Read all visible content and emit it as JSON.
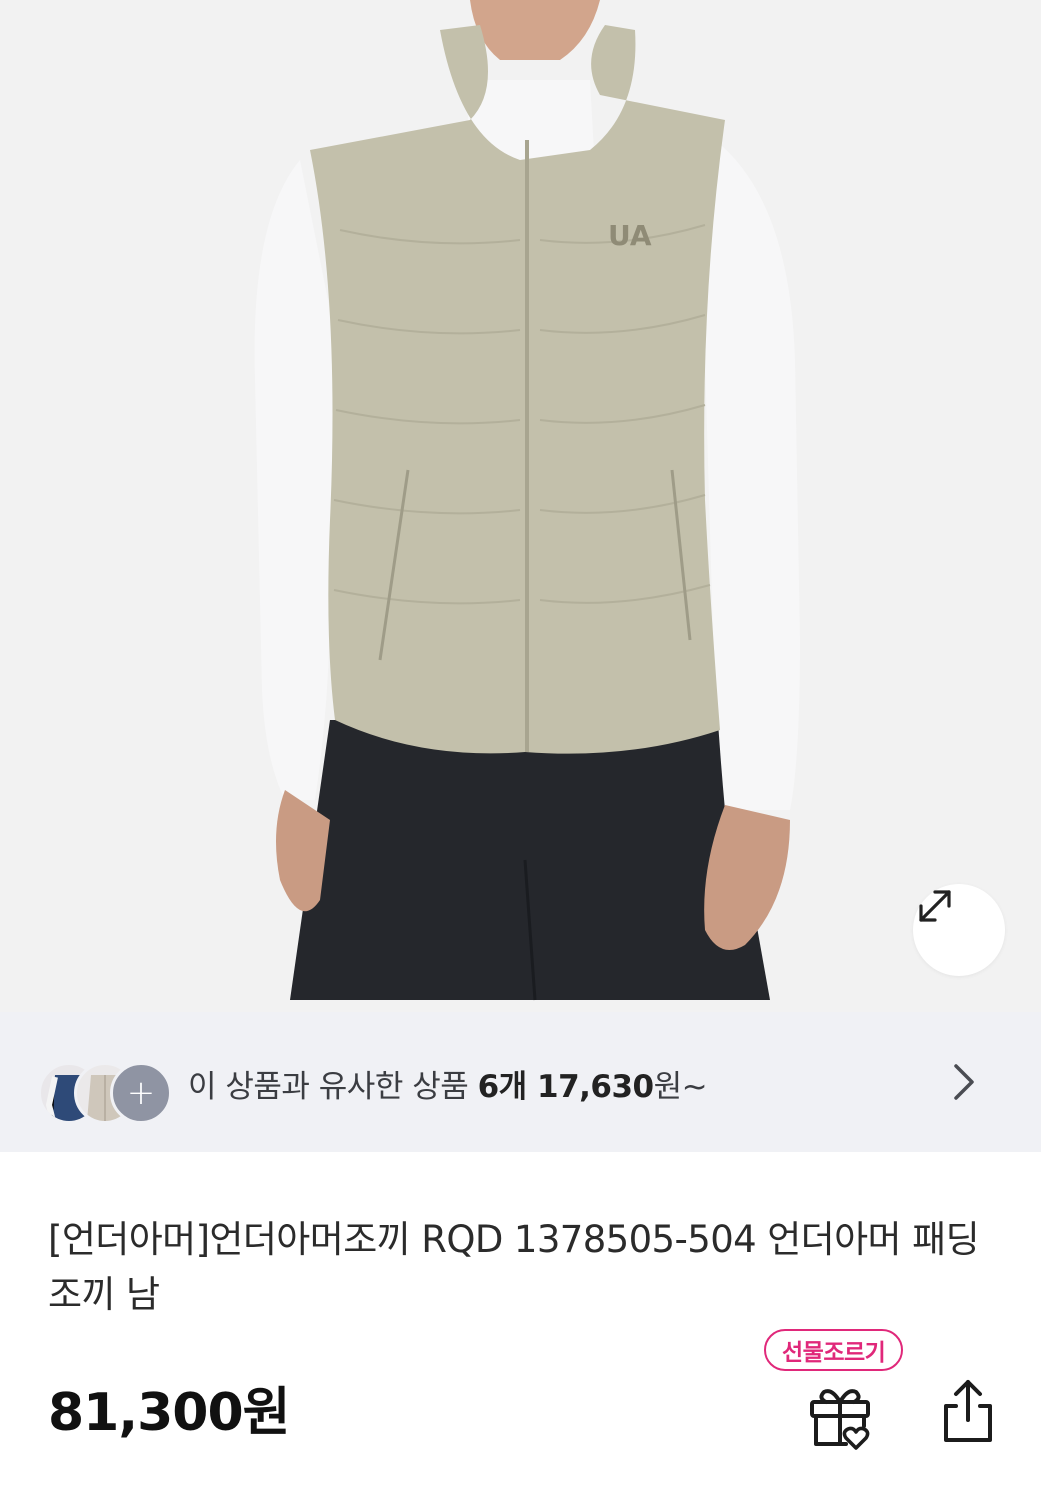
{
  "product_image": {
    "alt": ""
  },
  "zoom": {
    "icon": "expand-icon"
  },
  "similar": {
    "prefix": "이 상품과 유사한 상품 ",
    "count": "6개",
    "price": "17,630",
    "suffix": "원~",
    "more_symbol": "+"
  },
  "product": {
    "title": "[언더아머]언더아머조끼 RQD 1378505-504 언더아머 패딩 조끼 남",
    "price": "81,300원"
  },
  "actions": {
    "gift_badge": "선물조르기",
    "gift_icon": "gift-heart-icon",
    "share_icon": "share-icon"
  },
  "colors": {
    "accent": "#e0287a",
    "vest": "#c3c0ab",
    "shirt": "#f7f7f8",
    "pants": "#25272c",
    "similar_bg": "#f0f1f5"
  }
}
